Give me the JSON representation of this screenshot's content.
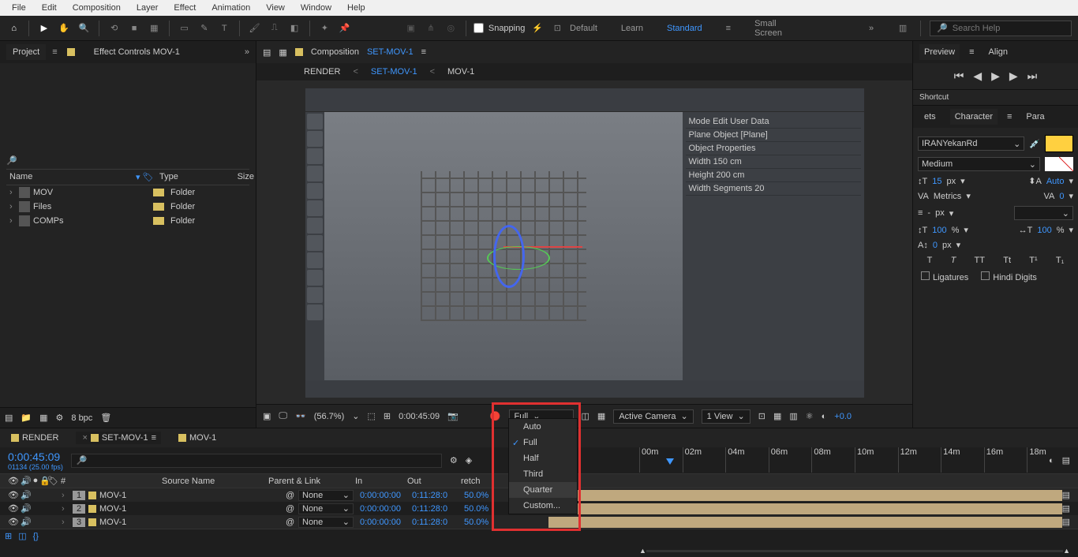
{
  "menubar": [
    "File",
    "Edit",
    "Composition",
    "Layer",
    "Effect",
    "Animation",
    "View",
    "Window",
    "Help"
  ],
  "toolbar": {
    "snapping": "Snapping",
    "workspaces": [
      "Default",
      "Learn",
      "Standard",
      "Small Screen"
    ],
    "active_workspace": "Standard",
    "search_placeholder": "Search Help"
  },
  "project": {
    "tab": "Project",
    "fx_tab": "Effect Controls MOV-1",
    "headers": {
      "name": "Name",
      "type": "Type",
      "size": "Size"
    },
    "rows": [
      {
        "name": "MOV",
        "type": "Folder"
      },
      {
        "name": "Files",
        "type": "Folder"
      },
      {
        "name": "COMPs",
        "type": "Folder"
      }
    ],
    "footer_bpc": "8 bpc"
  },
  "comp": {
    "label": "Composition",
    "active": "SET-MOV-1",
    "breadcrumb": [
      "RENDER",
      "SET-MOV-1",
      "MOV-1"
    ]
  },
  "viewer_footer": {
    "zoom": "(56.7%)",
    "time": "0:00:45:09",
    "resolution_selected": "Full",
    "camera": "Active Camera",
    "views": "1 View",
    "exposure": "+0.0"
  },
  "resolution_menu": {
    "items": [
      "Auto",
      "Full",
      "Half",
      "Third",
      "Quarter",
      "Custom..."
    ],
    "active": "Full",
    "hover": "Quarter"
  },
  "preview": {
    "tab": "Preview",
    "align_tab": "Align",
    "shortcut": "Shortcut"
  },
  "character": {
    "tab": "Character",
    "tabs_left": "ets",
    "tabs_right": "Para",
    "font": "IRANYekanRd",
    "weight": "Medium",
    "font_size": "15",
    "font_unit": "px",
    "leading": "Auto",
    "kerning": "Metrics",
    "tracking": "0",
    "line_v": "-",
    "line_u": "px",
    "vscale": "100",
    "hscale": "100",
    "baseline": "0",
    "pct": "%",
    "ligatures": "Ligatures",
    "hindi": "Hindi Digits",
    "style_buttons": [
      "T",
      "T",
      "TT",
      "Tt",
      "T¹",
      "T₁"
    ]
  },
  "timeline": {
    "tabs": [
      {
        "name": "RENDER",
        "active": false
      },
      {
        "name": "SET-MOV-1",
        "active": true
      },
      {
        "name": "MOV-1",
        "active": false
      }
    ],
    "timecode": "0:00:45:09",
    "fps": "01134 (25.00 fps)",
    "cols": {
      "src": "Source Name",
      "parent": "Parent & Link",
      "in": "In",
      "out": "Out",
      "stretch": "retch"
    },
    "rows": [
      {
        "n": "1",
        "name": "MOV-1",
        "parent": "None",
        "in": "0:00:00:00",
        "out": "0:11:28:0",
        "pct": "50.0%"
      },
      {
        "n": "2",
        "name": "MOV-1",
        "parent": "None",
        "in": "0:00:00:00",
        "out": "0:11:28:0",
        "pct": "50.0%"
      },
      {
        "n": "3",
        "name": "MOV-1",
        "parent": "None",
        "in": "0:00:00:00",
        "out": "0:11:28:0",
        "pct": "50.0%"
      }
    ],
    "ruler": [
      "00m",
      "02m",
      "04m",
      "06m",
      "08m",
      "10m",
      "12m",
      "14m",
      "16m",
      "18m"
    ]
  }
}
